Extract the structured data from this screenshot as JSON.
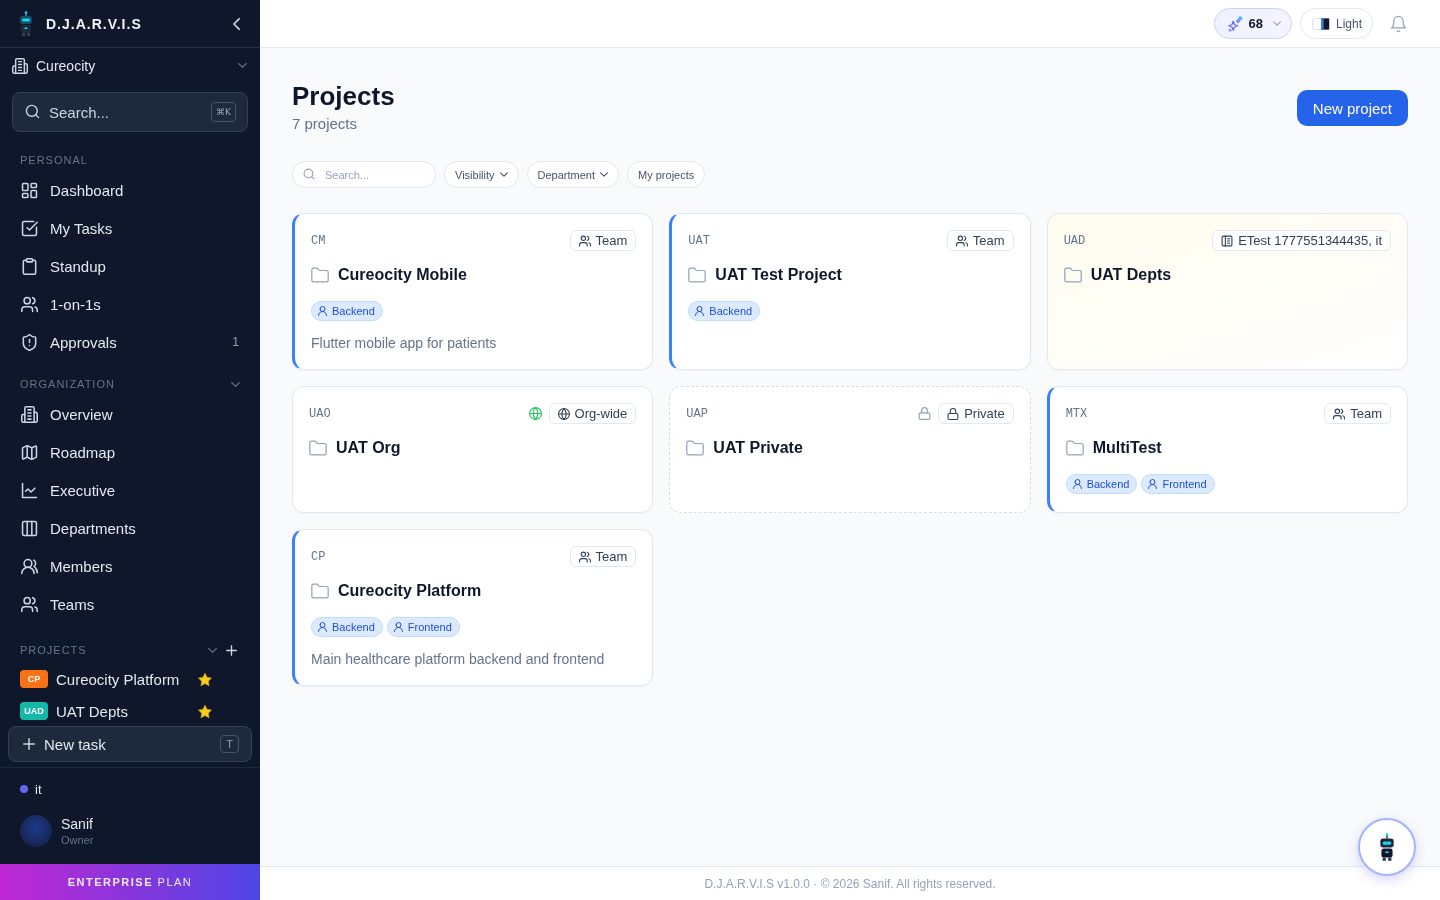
{
  "sidebar": {
    "brand": "D.J.A.R.V.I.S",
    "org": "Cureocity",
    "search": {
      "placeholder": "Search...",
      "shortcut": "⌘K"
    },
    "personal": {
      "label": "PERSONAL",
      "items": [
        {
          "label": "Dashboard",
          "selected": false
        },
        {
          "label": "My Tasks",
          "selected": false
        },
        {
          "label": "Standup",
          "selected": false
        },
        {
          "label": "1-on-1s",
          "selected": false
        },
        {
          "label": "Approvals",
          "selected": false,
          "count": "1"
        }
      ]
    },
    "organization": {
      "label": "ORGANIZATION",
      "expanded": true,
      "items": [
        {
          "label": "Overview",
          "selected": false
        },
        {
          "label": "Roadmap",
          "selected": false
        },
        {
          "label": "Executive",
          "selected": false
        },
        {
          "label": "Departments",
          "selected": false
        },
        {
          "label": "Members",
          "selected": false
        },
        {
          "label": "Teams",
          "selected": false
        }
      ]
    },
    "projects": {
      "label": "PROJECTS",
      "expanded": true,
      "items": [
        {
          "code": "CP",
          "name": "Cureocity Platform",
          "color": "#f97316",
          "starred": true
        },
        {
          "code": "UAD",
          "name": "UAT Depts",
          "color": "#14b8a6",
          "starred": true
        }
      ]
    },
    "new_task": {
      "label": "New task",
      "shortcut": "T"
    },
    "workspace": "it",
    "user": {
      "name": "Sanif",
      "role": "Owner"
    },
    "plan": "**ENTERPRISE** PLAN"
  },
  "topbar": {
    "credits": "68",
    "theme": "Light"
  },
  "page": {
    "title": "Projects",
    "subtitle": "7 projects",
    "primary_action": "New project"
  },
  "filters": {
    "search": {
      "placeholder": "Search..."
    },
    "chips": [
      {
        "kind": "dropdown",
        "label": "Visibility",
        "selected": false
      },
      {
        "kind": "dropdown",
        "label": "Department",
        "selected": false
      },
      {
        "kind": "toggle",
        "label": "My projects",
        "selected": false
      }
    ]
  },
  "projects": [
    {
      "key": "CM",
      "name": "Cureocity Mobile",
      "visibility": {
        "kind": "team",
        "label": "Team"
      },
      "tags": [
        "Backend"
      ],
      "description": "Flutter mobile app for patients"
    },
    {
      "key": "UAT",
      "name": "UAT Test Project",
      "visibility": {
        "kind": "team",
        "label": "Team"
      },
      "tags": [
        "Backend"
      ]
    },
    {
      "key": "UAD",
      "name": "UAT Depts",
      "visibility": {
        "kind": "department",
        "label": "ETest 1777551344435, it"
      }
    },
    {
      "key": "UAO",
      "name": "UAT Org",
      "visibility": {
        "kind": "org",
        "label": "Org-wide"
      }
    },
    {
      "key": "UAP",
      "name": "UAT Private",
      "visibility": {
        "kind": "private",
        "label": "Private"
      }
    },
    {
      "key": "MTX",
      "name": "MultiTest",
      "visibility": {
        "kind": "team",
        "label": "Team"
      },
      "tags": [
        "Backend",
        "Frontend"
      ]
    },
    {
      "key": "CP",
      "name": "Cureocity Platform",
      "visibility": {
        "kind": "team",
        "label": "Team"
      },
      "tags": [
        "Backend",
        "Frontend"
      ],
      "description": "Main healthcare platform backend and frontend"
    }
  ],
  "footer": "D.J.A.R.V.I.S v1.0.0 · © 2026 Sanif. All rights reserved."
}
